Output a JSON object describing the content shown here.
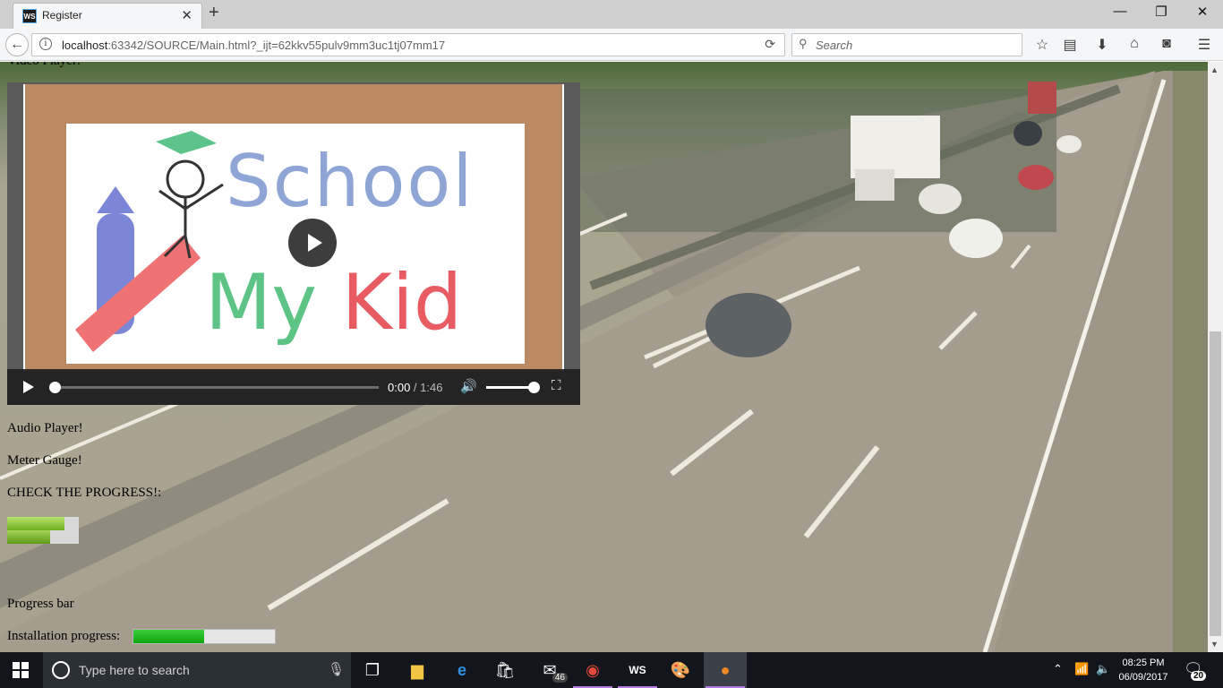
{
  "browser": {
    "tab_title": "Register",
    "tab_favicon_text": "WS",
    "url_host": "localhost",
    "url_path": ":63342/SOURCE/Main.html?_ijt=62kkv55pulv9mm3uc1tj07mm17",
    "search_placeholder": "Search"
  },
  "page": {
    "video_heading": "Video Player:",
    "audio_label": "Audio Player!",
    "meter_label": "Meter Gauge!",
    "check_progress_label": "CHECK THE PROGRESS!:",
    "progress_bar_label": "Progress bar",
    "installation_label": "Installation progress:",
    "meter_values": [
      0.8,
      0.6
    ],
    "installation_progress": 0.5
  },
  "video": {
    "logo_line1": "School",
    "logo_my": "My",
    "logo_kid": "Kid",
    "current_time": "0:00",
    "duration": "1:46",
    "time_separator": " / ",
    "played_fraction": 0,
    "volume_fraction": 1
  },
  "taskbar": {
    "search_placeholder": "Type here to search",
    "mail_badge": "46",
    "time": "08:25 PM",
    "date": "06/09/2017",
    "notification_count": "20"
  },
  "colors": {
    "progress_green": "#0ea70e",
    "meter_green": "#6fae1e"
  }
}
